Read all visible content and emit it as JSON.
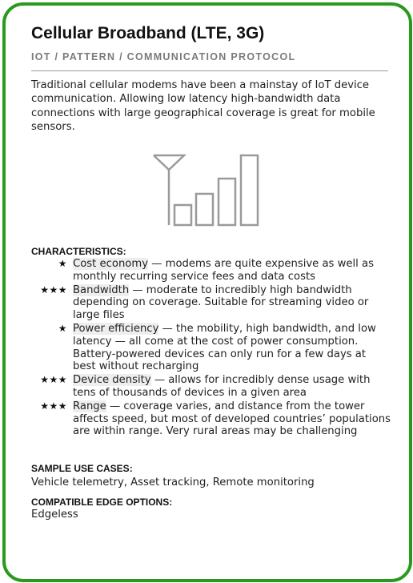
{
  "title": "Cellular Broadband (LTE, 3G)",
  "subtitle": "IOT / PATTERN / COMMUNICATION PROTOCOL",
  "description": "Traditional cellular modems have been a mainstay of IoT device communication. Allowing low latency high-bandwidth data connections with large geographical coverage is great for mobile sensors.",
  "illustration_icon": "cell-signal-icon",
  "accent_color": "#2a9a1e",
  "characteristics_heading": "CHARACTERISTICS:",
  "characteristics": [
    {
      "stars": "★",
      "rating": 1,
      "term": "Cost economy",
      "text": " — modems are quite expensive as well as monthly recurring service fees and data costs"
    },
    {
      "stars": "★★★",
      "rating": 3,
      "term": "Bandwidth",
      "text": " — moderate to incredibly high bandwidth depending on coverage. Suitable for streaming video or large files"
    },
    {
      "stars": "★",
      "rating": 1,
      "term": "Power efficiency",
      "text": " — the mobility, high bandwidth, and low latency — all come at the cost of power consumption. Battery-powered devices can only run for a few days at best without recharging"
    },
    {
      "stars": "★★★",
      "rating": 3,
      "term": "Device density",
      "text": " — allows for incredibly dense usage with tens of thousands of devices in a given area"
    },
    {
      "stars": "★★★",
      "rating": 3,
      "term": "Range",
      "text": " — coverage varies, and distance from the tower affects speed, but most of developed countries’ populations are within range. Very rural areas may be challenging"
    }
  ],
  "use_cases_heading": "SAMPLE USE CASES:",
  "use_cases": "Vehicle telemetry, Asset tracking, Remote monitoring",
  "edge_heading": "COMPATIBLE EDGE OPTIONS:",
  "edge_options": "Edgeless"
}
